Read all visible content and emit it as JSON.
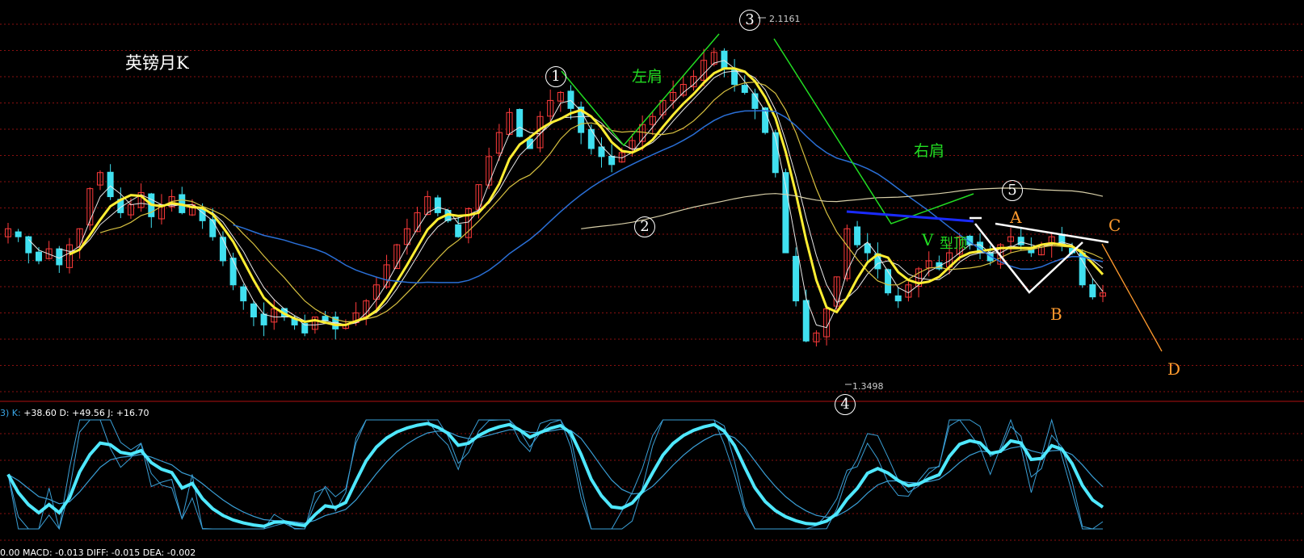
{
  "title": "英镑月K",
  "annotations": {
    "left_shoulder": "左肩",
    "right_shoulder": "右肩",
    "v_top": "型顶",
    "v_letter": "V",
    "points": {
      "p1": "①",
      "p2": "②",
      "p3": "③",
      "p4": "④",
      "p5": "⑤"
    },
    "abcd": {
      "a": "A",
      "b": "B",
      "c": "C",
      "d": "D"
    },
    "high_tag": "2.1161",
    "low_tag": "1.3498"
  },
  "kdj": {
    "prefix": "3) K:",
    "k": "+38.60",
    "d_label": "D:",
    "d": "+49.56",
    "j_label": "J:",
    "j": "+16.70"
  },
  "macd_partial": "0.00  MACD: -0.013  DIFF: -0.015  DEA: -0.002",
  "colors": {
    "background": "#000000",
    "up": "#ff3b3b",
    "down": "#40e0f0",
    "ma_white": "#e8e8e8",
    "ma_yellow_thick": "#ffee33",
    "ma_yellow_thin": "#d6c040",
    "ma_blue": "#2a6fd6",
    "ma_beige": "#d8cfa8",
    "grid": "#8a1010",
    "kdj_k": "#4fe8ff",
    "kdj_line": "#3a9fd6",
    "neckline_blue": "#1a2bff",
    "pattern_green": "#22dd22",
    "pattern_white": "#ffffff",
    "pattern_orange": "#ff9a2e"
  },
  "chart_data": {
    "type": "candlestick",
    "symbol": "英镑月K",
    "period": "monthly",
    "high": 2.1161,
    "low": 1.3498,
    "ylim": [
      1.3,
      2.15
    ],
    "closes": [
      1.66,
      1.64,
      1.6,
      1.58,
      1.61,
      1.57,
      1.62,
      1.66,
      1.76,
      1.8,
      1.74,
      1.7,
      1.72,
      1.75,
      1.69,
      1.72,
      1.74,
      1.7,
      1.72,
      1.68,
      1.64,
      1.58,
      1.52,
      1.48,
      1.44,
      1.42,
      1.46,
      1.44,
      1.42,
      1.4,
      1.44,
      1.43,
      1.41,
      1.42,
      1.45,
      1.48,
      1.52,
      1.57,
      1.62,
      1.66,
      1.7,
      1.74,
      1.7,
      1.68,
      1.64,
      1.71,
      1.77,
      1.84,
      1.9,
      1.95,
      1.89,
      1.86,
      1.94,
      1.98,
      2.0,
      1.96,
      1.9,
      1.86,
      1.84,
      1.82,
      1.85,
      1.88,
      1.92,
      1.94,
      1.98,
      2.0,
      2.02,
      2.04,
      2.08,
      2.1,
      2.06,
      2.02,
      2.0,
      1.96,
      1.9,
      1.8,
      1.6,
      1.48,
      1.38,
      1.4,
      1.46,
      1.54,
      1.66,
      1.62,
      1.6,
      1.56,
      1.5,
      1.48,
      1.52,
      1.56,
      1.58,
      1.56,
      1.6,
      1.64,
      1.62,
      1.6,
      1.58,
      1.62,
      1.64,
      1.62,
      1.6,
      1.62,
      1.64,
      1.62,
      1.6,
      1.52,
      1.49,
      1.5
    ]
  }
}
